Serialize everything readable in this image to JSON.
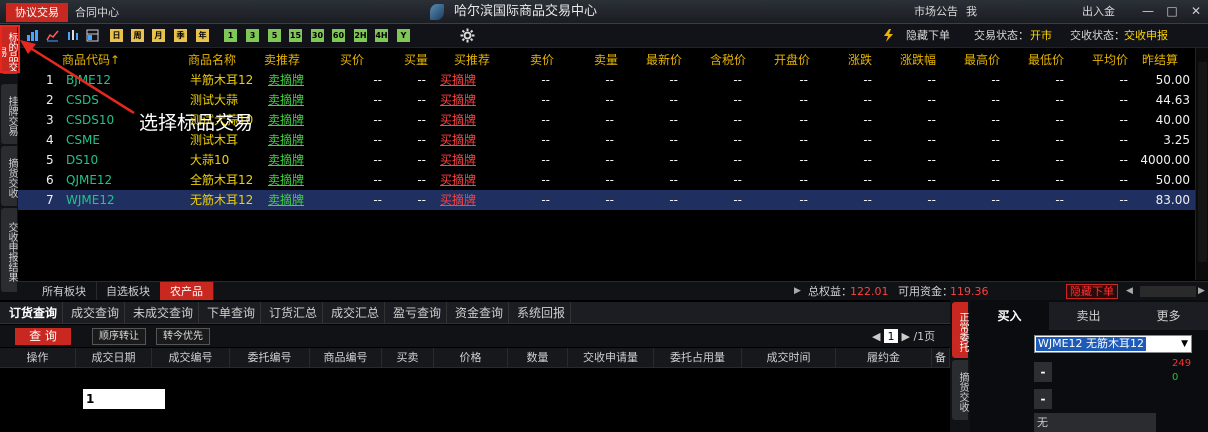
{
  "titlebar": {
    "tab_active": "协议交易",
    "tab_contract": "合同中心",
    "title": "哈尔滨国际商品交易中心",
    "market_notice": "市场公告",
    "mine": "我",
    "inout": "出入金",
    "minimize": "—",
    "maximize": "□",
    "close": "✕"
  },
  "left_tabs": [
    "标的品交易",
    "挂牌交易",
    "摘货交收",
    "交收申报结果"
  ],
  "toolbar": {
    "periods": [
      "日",
      "周",
      "月",
      "季",
      "年",
      "1",
      "3",
      "5",
      "15",
      "30",
      "60",
      "2H",
      "4H",
      "Y"
    ],
    "hide_order": "隐藏下单",
    "trade_status_label": "交易状态：",
    "trade_status": "开市",
    "delivery_status_label": "交收状态：",
    "delivery_status": "交收申报"
  },
  "quote_table": {
    "headers": [
      "商品代码↑",
      "商品名称",
      "卖推荐",
      "买价",
      "买量",
      "买推荐",
      "卖价",
      "卖量",
      "最新价",
      "含税价",
      "开盘价",
      "涨跌",
      "涨跌幅",
      "最高价",
      "最低价",
      "平均价",
      "昨结算"
    ],
    "rows": [
      {
        "no": "1",
        "code": "BJME12",
        "name": "半筋木耳12",
        "sell_rec": "卖摘牌",
        "bid": "--",
        "bid_qty": "--",
        "buy_rec": "买摘牌",
        "ask": "--",
        "ask_qty": "--",
        "last": "--",
        "tax": "--",
        "open": "--",
        "chg": "--",
        "chg_pct": "--",
        "high": "--",
        "low": "--",
        "avg": "--",
        "prev": "50.00"
      },
      {
        "no": "2",
        "code": "CSDS",
        "name": "测试大蒜",
        "sell_rec": "卖摘牌",
        "bid": "--",
        "bid_qty": "--",
        "buy_rec": "买摘牌",
        "ask": "--",
        "ask_qty": "--",
        "last": "--",
        "tax": "--",
        "open": "--",
        "chg": "--",
        "chg_pct": "--",
        "high": "--",
        "low": "--",
        "avg": "--",
        "prev": "44.63"
      },
      {
        "no": "3",
        "code": "CSDS10",
        "name": "测试大蒜10",
        "sell_rec": "卖摘牌",
        "bid": "--",
        "bid_qty": "--",
        "buy_rec": "买摘牌",
        "ask": "--",
        "ask_qty": "--",
        "last": "--",
        "tax": "--",
        "open": "--",
        "chg": "--",
        "chg_pct": "--",
        "high": "--",
        "low": "--",
        "avg": "--",
        "prev": "40.00"
      },
      {
        "no": "4",
        "code": "CSME",
        "name": "测试木耳",
        "sell_rec": "卖摘牌",
        "bid": "--",
        "bid_qty": "--",
        "buy_rec": "买摘牌",
        "ask": "--",
        "ask_qty": "--",
        "last": "--",
        "tax": "--",
        "open": "--",
        "chg": "--",
        "chg_pct": "--",
        "high": "--",
        "low": "--",
        "avg": "--",
        "prev": "3.25"
      },
      {
        "no": "5",
        "code": "DS10",
        "name": "大蒜10",
        "sell_rec": "卖摘牌",
        "bid": "--",
        "bid_qty": "--",
        "buy_rec": "买摘牌",
        "ask": "--",
        "ask_qty": "--",
        "last": "--",
        "tax": "--",
        "open": "--",
        "chg": "--",
        "chg_pct": "--",
        "high": "--",
        "low": "--",
        "avg": "--",
        "prev": "4000.00"
      },
      {
        "no": "6",
        "code": "QJME12",
        "name": "全筋木耳12",
        "sell_rec": "卖摘牌",
        "bid": "--",
        "bid_qty": "--",
        "buy_rec": "买摘牌",
        "ask": "--",
        "ask_qty": "--",
        "last": "--",
        "tax": "--",
        "open": "--",
        "chg": "--",
        "chg_pct": "--",
        "high": "--",
        "low": "--",
        "avg": "--",
        "prev": "50.00"
      },
      {
        "no": "7",
        "code": "WJME12",
        "name": "无筋木耳12",
        "sell_rec": "卖摘牌",
        "bid": "--",
        "bid_qty": "--",
        "buy_rec": "买摘牌",
        "ask": "--",
        "ask_qty": "--",
        "last": "--",
        "tax": "--",
        "open": "--",
        "chg": "--",
        "chg_pct": "--",
        "high": "--",
        "low": "--",
        "avg": "--",
        "prev": "83.00"
      }
    ],
    "selected_index": 6
  },
  "annotation": {
    "text": "选择标品交易",
    "color": "#e8281e"
  },
  "sectorbar": {
    "sectors": [
      "所有板块",
      "自选板块",
      "农产品"
    ],
    "active": "农产品",
    "equity_label": "总权益：",
    "equity": "122.01",
    "available_label": "可用资金：",
    "available": "119.36",
    "hide_order": "隐藏下单"
  },
  "bottom": {
    "tabs": [
      "订货查询",
      "成交查询",
      "未成交查询",
      "下单查询",
      "订货汇总",
      "成交汇总",
      "盈亏查询",
      "资金查询",
      "系统回报"
    ],
    "query": "查 询",
    "order_transfer": "顺序转让",
    "transfer_priority": "转今优先",
    "page": "1",
    "page_total": "/1页",
    "headers": [
      "操作",
      "成交日期",
      "成交编号",
      "委托编号",
      "商品编号",
      "买卖",
      "价格",
      "数量",
      "交收申请量",
      "委托占用量",
      "成交时间",
      "履约金",
      "备"
    ]
  },
  "right_vtabs": [
    "正常委托",
    "摘货交收"
  ],
  "order": {
    "tabs": [
      "买入",
      "卖出",
      "更多"
    ],
    "product": "WJME12 无筋木耳12",
    "up_value": "249",
    "down_value": "0",
    "minus": "-",
    "qty": "1",
    "none": "无"
  },
  "colors": {
    "brand_red": "#c8281f",
    "selected_row": "#1f2f5f",
    "header_yellow": "#e6b400",
    "code_green": "#22c38a"
  }
}
